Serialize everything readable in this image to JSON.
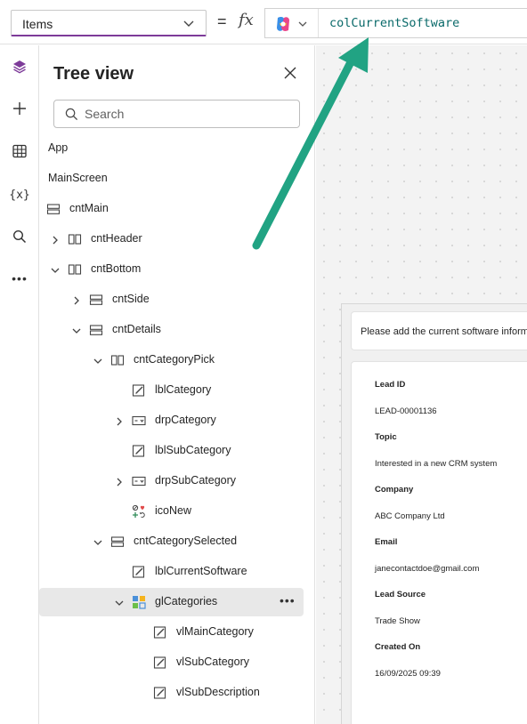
{
  "formula_bar": {
    "property": "Items",
    "formula": "colCurrentSoftware"
  },
  "rail": {
    "icons": [
      "layers-icon",
      "plus-icon",
      "table-icon",
      "variables-icon",
      "search-icon",
      "more-icon"
    ]
  },
  "tree": {
    "title": "Tree view",
    "search_placeholder": "Search",
    "nodes": [
      {
        "label": "App",
        "level": 0
      },
      {
        "label": "MainScreen",
        "level": 0
      },
      {
        "label": "cntMain",
        "level": 0
      },
      {
        "label": "cntHeader",
        "level": 1
      },
      {
        "label": "cntBottom",
        "level": 1
      },
      {
        "label": "cntSide",
        "level": 2
      },
      {
        "label": "cntDetails",
        "level": 2
      },
      {
        "label": "cntCategoryPick",
        "level": 3
      },
      {
        "label": "lblCategory",
        "level": 4
      },
      {
        "label": "drpCategory",
        "level": 4
      },
      {
        "label": "lblSubCategory",
        "level": 4
      },
      {
        "label": "drpSubCategory",
        "level": 4
      },
      {
        "label": "icoNew",
        "level": 4
      },
      {
        "label": "cntCategorySelected",
        "level": 3
      },
      {
        "label": "lblCurrentSoftware",
        "level": 4
      },
      {
        "label": "glCategories",
        "level": 4,
        "selected": true
      },
      {
        "label": "vlMainCategory",
        "level": 5
      },
      {
        "label": "vlSubCategory",
        "level": 5
      },
      {
        "label": "vlSubDescription",
        "level": 5
      }
    ]
  },
  "canvas": {
    "info_text": "Please add the current software inform",
    "fields": [
      {
        "label": "Lead ID",
        "value": "LEAD-00001136"
      },
      {
        "label": "Topic",
        "value": "Interested in a new CRM system"
      },
      {
        "label": "Company",
        "value": "ABC Company Ltd"
      },
      {
        "label": "Email",
        "value": "janecontactdoe@gmail.com"
      },
      {
        "label": "Lead Source",
        "value": "Trade Show"
      },
      {
        "label": "Created On",
        "value": "16/09/2025 09:39"
      }
    ]
  },
  "colors": {
    "accent": "#7d3b99",
    "arrow": "#21a383",
    "formula_text": "#0a6a6a",
    "selected_row": "#e8e8e8"
  }
}
